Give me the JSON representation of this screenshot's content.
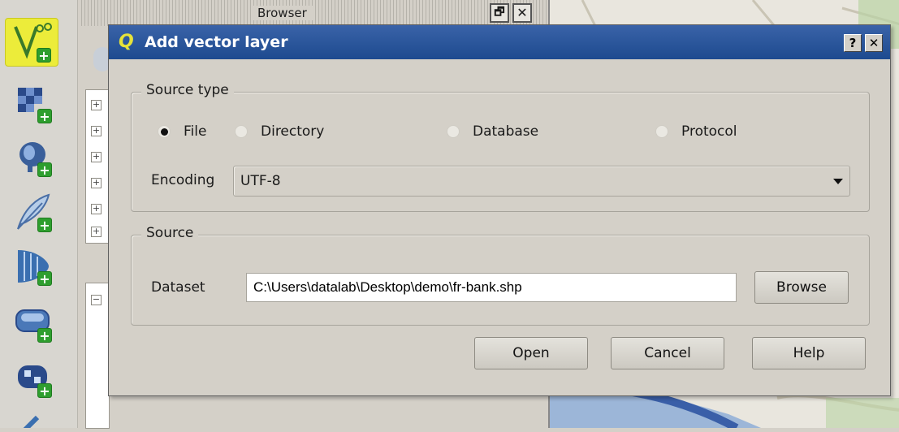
{
  "browser_panel": {
    "title": "Browser",
    "float_button": "🗗",
    "close_button": "✕"
  },
  "toolbar": {
    "tools": [
      {
        "icon": "add-vector-layer-icon",
        "active": true
      },
      {
        "icon": "add-raster-layer-icon"
      },
      {
        "icon": "add-postgis-layer-icon"
      },
      {
        "icon": "add-spatialite-layer-icon"
      },
      {
        "icon": "add-wms-layer-icon"
      },
      {
        "icon": "add-mssql-layer-icon"
      },
      {
        "icon": "add-wcs-layer-icon"
      },
      {
        "icon": "add-wfs-layer-icon"
      }
    ],
    "active_color": "#ecec3a",
    "plus_color": "#2e9e2e"
  },
  "dialog": {
    "title": "Add vector layer",
    "help_button": "?",
    "close_button": "✕",
    "titlebar_color": "#1d4a8f",
    "source_type": {
      "legend": "Source type",
      "options": [
        {
          "label": "File",
          "checked": true
        },
        {
          "label": "Directory",
          "checked": false
        },
        {
          "label": "Database",
          "checked": false
        },
        {
          "label": "Protocol",
          "checked": false
        }
      ],
      "encoding_label": "Encoding",
      "encoding_value": "UTF-8"
    },
    "source": {
      "legend": "Source",
      "dataset_label": "Dataset",
      "dataset_value": "C:\\Users\\datalab\\Desktop\\demo\\fr-bank.shp",
      "browse_button": "Browse"
    },
    "buttons": {
      "open": "Open",
      "cancel": "Cancel",
      "help": "Help"
    }
  }
}
